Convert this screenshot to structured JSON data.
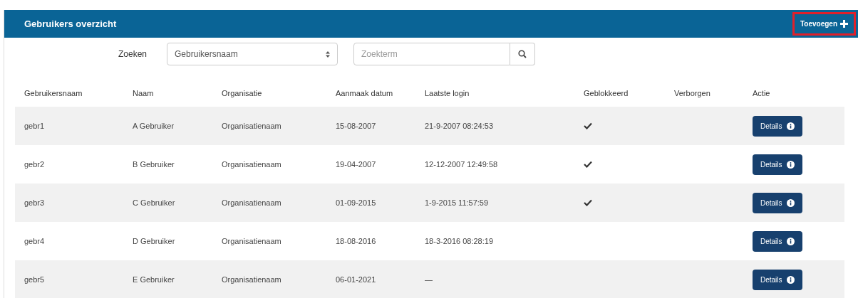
{
  "header": {
    "title": "Gebruikers overzicht",
    "add_button": {
      "label": "Toevoegen",
      "highlighted": true
    }
  },
  "search": {
    "label": "Zoeken",
    "field_select": {
      "value": "Gebruikersnaam"
    },
    "query": {
      "placeholder": "Zoekterm"
    }
  },
  "table": {
    "columns": [
      "Gebruikersnaam",
      "Naam",
      "Organisatie",
      "Aanmaak datum",
      "Laatste login",
      "Geblokkeerd",
      "Verborgen",
      "Actie"
    ],
    "rows": [
      {
        "username": "gebr1",
        "name": "A Gebruiker",
        "organisation": "Organisatienaam",
        "created": "15-08-2007",
        "last_login": "21-9-2007 08:24:53",
        "blocked": true,
        "action": "Details"
      },
      {
        "username": "gebr2",
        "name": "B Gebruiker",
        "organisation": "Organisatienaam",
        "created": "19-04-2007",
        "last_login": "12-12-2007 12:49:58",
        "blocked": true,
        "action": "Details"
      },
      {
        "username": "gebr3",
        "name": "C Gebruiker",
        "organisation": "Organisatienaam",
        "created": "01-09-2015",
        "last_login": "1-9-2015 11:57:59",
        "blocked": true,
        "action": "Details"
      },
      {
        "username": "gebr4",
        "name": "D Gebruiker",
        "organisation": "Organisatienaam",
        "created": "18-08-2016",
        "last_login": "18-3-2016 08:28:19",
        "blocked": false,
        "action": "Details"
      },
      {
        "username": "gebr5",
        "name": "E Gebruiker",
        "organisation": "Organisatienaam",
        "created": "06-01-2021",
        "last_login": "—",
        "blocked": false,
        "action": "Details"
      }
    ]
  }
}
